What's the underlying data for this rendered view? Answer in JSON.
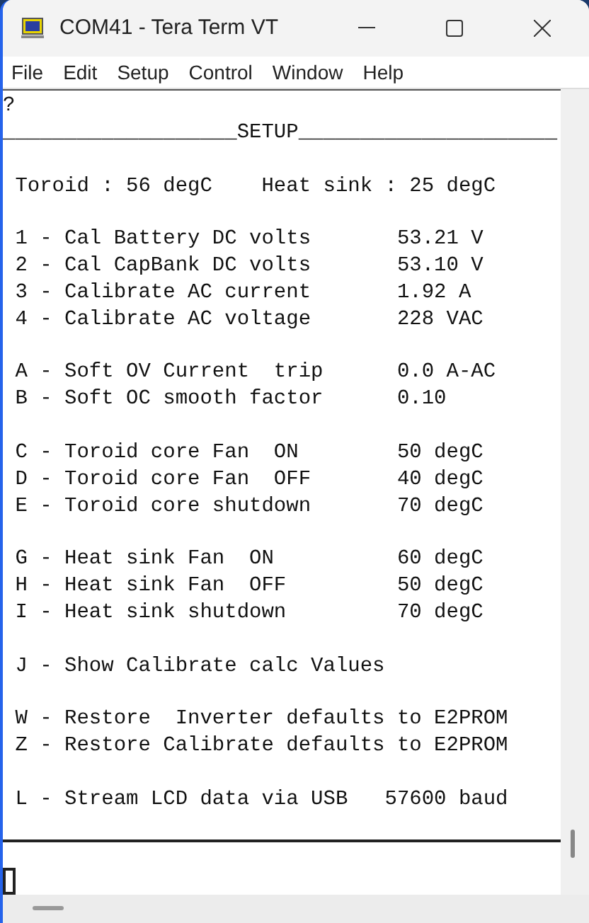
{
  "window": {
    "title": "COM41 - Tera Term VT"
  },
  "menu": [
    "File",
    "Edit",
    "Setup",
    "Control",
    "Window",
    "Help"
  ],
  "terminal": {
    "groups": [
      [
        "?",
        "___________________SETUP_____________________"
      ],
      [
        " Toroid : 56 degC    Heat sink : 25 degC"
      ],
      [
        " 1 - Cal Battery DC volts       53.21 V",
        " 2 - Cal CapBank DC volts       53.10 V",
        " 3 - Calibrate AC current       1.92 A",
        " 4 - Calibrate AC voltage       228 VAC"
      ],
      [
        " A - Soft OV Current  trip      0.0 A-AC",
        " B - Soft OC smooth factor      0.10"
      ],
      [
        " C - Toroid core Fan  ON        50 degC",
        " D - Toroid core Fan  OFF       40 degC",
        " E - Toroid core shutdown       70 degC"
      ],
      [
        " G - Heat sink Fan  ON          60 degC",
        " H - Heat sink Fan  OFF         50 degC",
        " I - Heat sink shutdown         70 degC"
      ],
      [
        " J - Show Calibrate calc Values"
      ],
      [
        " W - Restore  Inverter defaults to E2PROM",
        " Z - Restore Calibrate defaults to E2PROM"
      ],
      [
        " L - Stream LCD data via USB   57600 baud"
      ]
    ]
  }
}
